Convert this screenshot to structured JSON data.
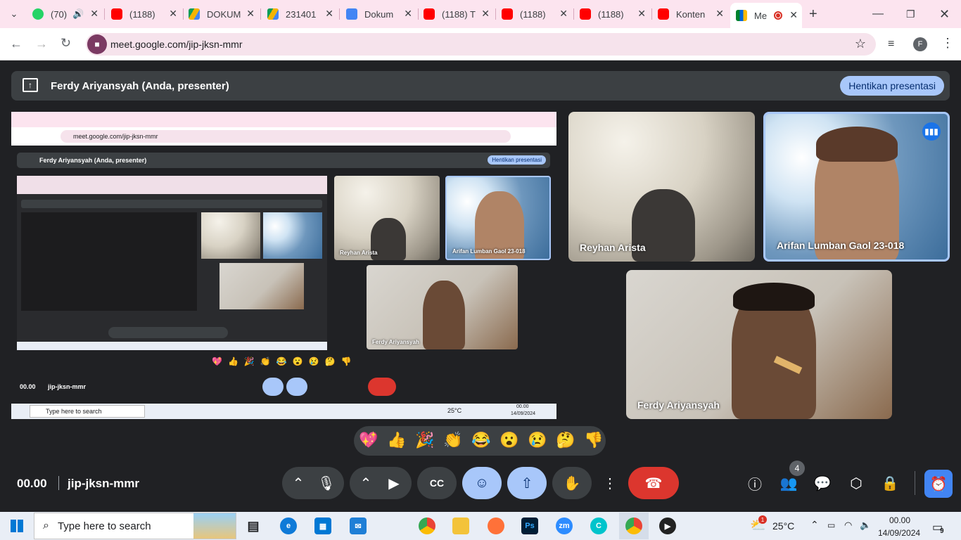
{
  "browser": {
    "tabs": [
      {
        "label": "(70)",
        "icon": "whatsapp-icon"
      },
      {
        "label": "(1188)",
        "icon": "youtube-icon"
      },
      {
        "label": "DOKUM",
        "icon": "google-drive-icon"
      },
      {
        "label": "231401",
        "icon": "google-drive-icon"
      },
      {
        "label": "Dokum",
        "icon": "google-docs-icon"
      },
      {
        "label": "(1188) T",
        "icon": "youtube-icon"
      },
      {
        "label": "(1188)",
        "icon": "youtube-icon"
      },
      {
        "label": "(1188)",
        "icon": "youtube-icon"
      },
      {
        "label": "Konten",
        "icon": "youtube-icon"
      },
      {
        "label": "Me",
        "icon": "google-meet-icon"
      }
    ],
    "url": "meet.google.com/jip-jksn-mmr",
    "profile_initial": "F"
  },
  "meet": {
    "presenter_text": "Ferdy Ariyansyah (Anda, presenter)",
    "stop_button": "Hentikan presentasi",
    "participants": [
      {
        "name": "Reyhan Arista"
      },
      {
        "name": "Arifan Lumban Gaol 23-018"
      },
      {
        "name": "Ferdy Ariyansyah"
      }
    ],
    "time": "00.00",
    "meeting_code": "jip-jksn-mmr",
    "participant_count": "4",
    "reactions": [
      "💖",
      "👍",
      "🎉",
      "👏",
      "😂",
      "😮",
      "😢",
      "🤔",
      "👎"
    ]
  },
  "taskbar": {
    "search_placeholder": "Type here to search",
    "weather": "25°C",
    "clock_time": "00.00",
    "clock_date": "14/09/2024",
    "notif_count": "9",
    "weather_badge": "1"
  },
  "colors": {
    "accent": "#a8c7fa",
    "end_call": "#dc362e",
    "tab_bg": "#fce4ef"
  }
}
